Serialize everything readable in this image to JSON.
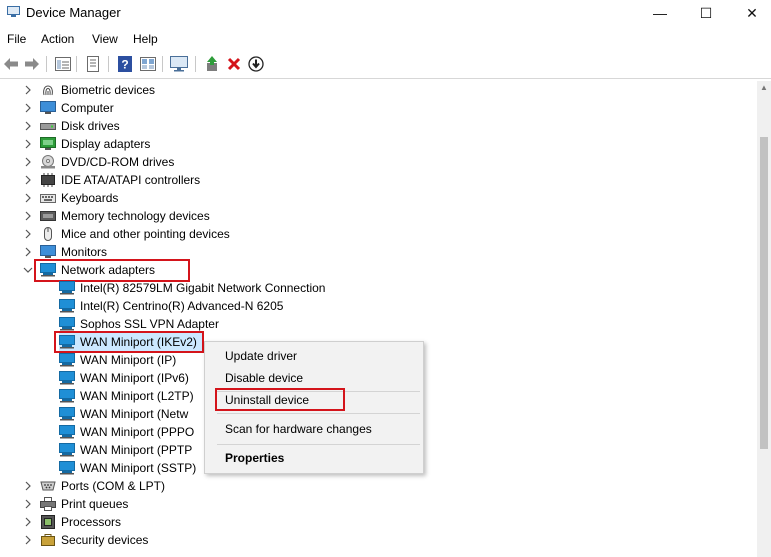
{
  "window": {
    "title": "Device Manager",
    "controls": {
      "minimize": "—",
      "maximize": "☐",
      "close": "✕"
    }
  },
  "menu": [
    "File",
    "Action",
    "View",
    "Help"
  ],
  "toolbar": [
    "back-icon",
    "forward-icon",
    "properties-grid-icon",
    "show-hide-icon",
    "help-icon",
    "view-icon",
    "scan-monitor-icon",
    "update-driver-icon",
    "remove-x-icon",
    "download-icon"
  ],
  "tree": {
    "categories_top": [
      {
        "label": "Biometric devices",
        "icon": "fingerprint-icon"
      },
      {
        "label": "Computer",
        "icon": "computer-icon"
      },
      {
        "label": "Disk drives",
        "icon": "disk-icon"
      },
      {
        "label": "Display adapters",
        "icon": "display-icon"
      },
      {
        "label": "DVD/CD-ROM drives",
        "icon": "dvd-icon"
      },
      {
        "label": "IDE ATA/ATAPI controllers",
        "icon": "ide-icon"
      },
      {
        "label": "Keyboards",
        "icon": "keyboard-icon"
      },
      {
        "label": "Memory technology devices",
        "icon": "memory-icon"
      },
      {
        "label": "Mice and other pointing devices",
        "icon": "mouse-icon"
      },
      {
        "label": "Monitors",
        "icon": "monitor-icon"
      }
    ],
    "expanded": {
      "label": "Network adapters",
      "icon": "network-icon"
    },
    "children": [
      "Intel(R) 82579LM Gigabit Network Connection",
      "Intel(R) Centrino(R) Advanced-N 6205",
      "Sophos SSL VPN Adapter",
      "WAN Miniport (IKEv2)",
      "WAN Miniport (IP)",
      "WAN Miniport (IPv6)",
      "WAN Miniport (L2TP)",
      "WAN Miniport (Netw",
      "WAN Miniport (PPPO",
      "WAN Miniport (PPTP",
      "WAN Miniport (SSTP)"
    ],
    "categories_bottom": [
      {
        "label": "Ports (COM & LPT)",
        "icon": "port-icon"
      },
      {
        "label": "Print queues",
        "icon": "printer-icon"
      },
      {
        "label": "Processors",
        "icon": "processor-icon"
      },
      {
        "label": "Security devices",
        "icon": "security-icon"
      }
    ]
  },
  "context_menu": {
    "update": "Update driver",
    "disable": "Disable device",
    "uninstall": "Uninstall device",
    "scan": "Scan for hardware changes",
    "properties": "Properties"
  },
  "colors": {
    "highlight_border": "#d4141b",
    "selected_bg": "#cce8ff",
    "network_icon": "#1f8fd6"
  }
}
